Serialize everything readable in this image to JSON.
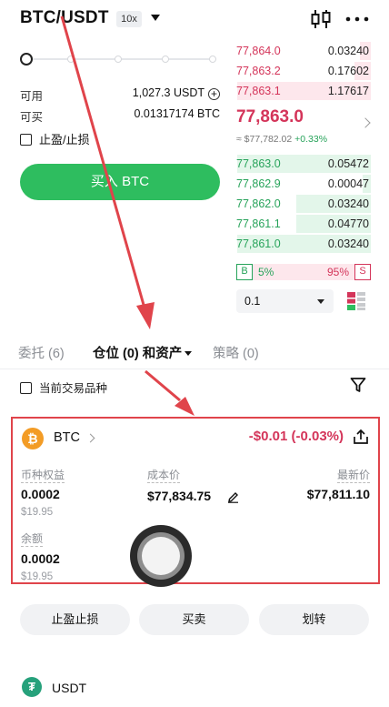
{
  "header": {
    "pair": "BTC/USDT",
    "leverage": "10x"
  },
  "trade_form": {
    "available_label": "可用",
    "available_value": "1,027.3 USDT",
    "buyable_label": "可买",
    "buyable_value": "0.01317174 BTC",
    "tpsl_label": "止盈/止损",
    "buy_button": "买入 BTC"
  },
  "order_book": {
    "asks": [
      {
        "price": "77,864.0",
        "qty": "0.03240",
        "depth": 0.08
      },
      {
        "price": "77,863.2",
        "qty": "0.17602",
        "depth": 0.12
      },
      {
        "price": "77,863.1",
        "qty": "1.17617",
        "depth": 0.98
      }
    ],
    "last_price": "77,863.0",
    "last_price_ref": "≈ $77,782.02",
    "last_change": "+0.33%",
    "bids": [
      {
        "price": "77,863.0",
        "qty": "0.05472",
        "depth": 0.98
      },
      {
        "price": "77,862.9",
        "qty": "0.00047",
        "depth": 0.06
      },
      {
        "price": "77,862.0",
        "qty": "0.03240",
        "depth": 0.55
      },
      {
        "price": "77,861.1",
        "qty": "0.04770",
        "depth": 0.55
      },
      {
        "price": "77,861.0",
        "qty": "0.03240",
        "depth": 0.98
      }
    ],
    "buy_letter": "B",
    "sell_letter": "S",
    "buy_ratio": "5%",
    "sell_ratio": "95%",
    "buy_ratio_value": 0.05,
    "depth_step": "0.1"
  },
  "tabs": {
    "orders": "委托 (6)",
    "positions": "仓位 (0) 和资产",
    "strategy": "策略 (0)"
  },
  "filter": {
    "current_pair_label": "当前交易品种"
  },
  "position_card": {
    "coin_symbol": "₿",
    "coin": "BTC",
    "pnl": "-$0.01 (-0.03%)",
    "equity_label": "币种权益",
    "equity_value": "0.0002",
    "equity_usd": "$19.95",
    "cost_label": "成本价",
    "cost_value": "$77,834.75",
    "last_label": "最新价",
    "last_value": "$77,811.10",
    "balance_label": "余额",
    "balance_value": "0.0002",
    "balance_usd": "$19.95"
  },
  "actions": {
    "tpsl": "止盈止损",
    "trade": "买卖",
    "transfer": "划转"
  },
  "asset_row": {
    "coin_symbol": "₮",
    "coin": "USDT"
  },
  "colors": {
    "buy_green": "#2ebd5f",
    "sell_red": "#d4355a",
    "highlight_red": "#e0444b"
  }
}
